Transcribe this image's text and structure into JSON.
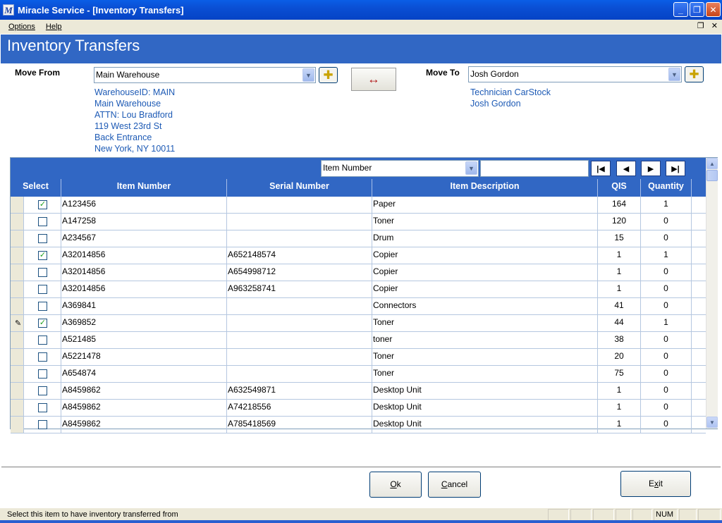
{
  "window": {
    "title": "Miracle Service - [Inventory Transfers]",
    "logo": "M"
  },
  "menu": {
    "items": [
      "Options",
      "Help"
    ]
  },
  "page": {
    "title": "Inventory Transfers"
  },
  "move_from": {
    "label": "Move From",
    "value": "Main Warehouse",
    "address": [
      "WarehouseID: MAIN",
      "Main Warehouse",
      "ATTN: Lou Bradford",
      "119 West 23rd St",
      "Back Entrance",
      "New York, NY 10011"
    ]
  },
  "move_to": {
    "label": "Move To",
    "value": "Josh Gordon",
    "address": [
      "Technician CarStock",
      "Josh Gordon"
    ]
  },
  "swap_icon": "↔",
  "grid": {
    "filter_field": "Item Number",
    "filter_value": "",
    "columns": [
      "Select",
      "Item Number",
      "Serial Number",
      "Item Description",
      "QIS",
      "Quantity"
    ],
    "rows": [
      {
        "checked": true,
        "item": "A123456",
        "serial": "",
        "desc": "Paper",
        "qis": "164",
        "qty": "1",
        "editing": false
      },
      {
        "checked": false,
        "item": "A147258",
        "serial": "",
        "desc": "Toner",
        "qis": "120",
        "qty": "0",
        "editing": false
      },
      {
        "checked": false,
        "item": "A234567",
        "serial": "",
        "desc": "Drum",
        "qis": "15",
        "qty": "0",
        "editing": false
      },
      {
        "checked": true,
        "item": "A32014856",
        "serial": "A652148574",
        "desc": "Copier",
        "qis": "1",
        "qty": "1",
        "editing": false
      },
      {
        "checked": false,
        "item": "A32014856",
        "serial": "A654998712",
        "desc": "Copier",
        "qis": "1",
        "qty": "0",
        "editing": false
      },
      {
        "checked": false,
        "item": "A32014856",
        "serial": "A963258741",
        "desc": "Copier",
        "qis": "1",
        "qty": "0",
        "editing": false
      },
      {
        "checked": false,
        "item": "A369841",
        "serial": "",
        "desc": "Connectors",
        "qis": "41",
        "qty": "0",
        "editing": false
      },
      {
        "checked": true,
        "item": "A369852",
        "serial": "",
        "desc": "Toner",
        "qis": "44",
        "qty": "1",
        "editing": true
      },
      {
        "checked": false,
        "item": "A521485",
        "serial": "",
        "desc": "toner",
        "qis": "38",
        "qty": "0",
        "editing": false
      },
      {
        "checked": false,
        "item": "A5221478",
        "serial": "",
        "desc": "Toner",
        "qis": "20",
        "qty": "0",
        "editing": false
      },
      {
        "checked": false,
        "item": "A654874",
        "serial": "",
        "desc": "Toner",
        "qis": "75",
        "qty": "0",
        "editing": false
      },
      {
        "checked": false,
        "item": "A8459862",
        "serial": "A632549871",
        "desc": "Desktop Unit",
        "qis": "1",
        "qty": "0",
        "editing": false
      },
      {
        "checked": false,
        "item": "A8459862",
        "serial": "A74218556",
        "desc": "Desktop Unit",
        "qis": "1",
        "qty": "0",
        "editing": false
      },
      {
        "checked": false,
        "item": "A8459862",
        "serial": "A785418569",
        "desc": "Desktop Unit",
        "qis": "1",
        "qty": "0",
        "editing": false
      }
    ]
  },
  "buttons": {
    "ok_hotkey": "O",
    "ok_rest": "k",
    "cancel_hotkey": "C",
    "cancel_rest": "ancel",
    "exit_pre": "E",
    "exit_hotkey": "x",
    "exit_rest": "it"
  },
  "status": {
    "text": "Select this item to have inventory transferred from",
    "num": "NUM"
  },
  "colors": {
    "header_blue": "#3167c4",
    "link_blue": "#1d5ab5",
    "titlebar": "#0a4fd4"
  }
}
